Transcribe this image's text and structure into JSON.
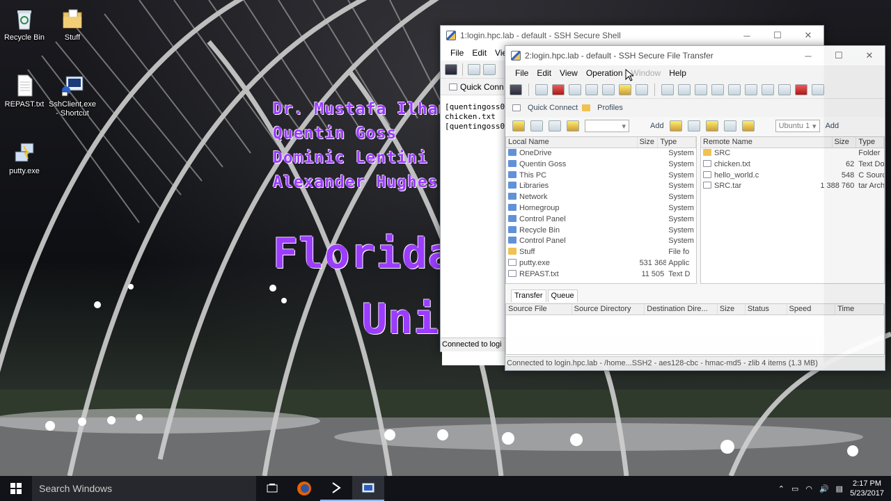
{
  "desktop": {
    "icons": [
      {
        "label": "Recycle Bin"
      },
      {
        "label": "Stuff"
      },
      {
        "label": "REPAST.txt"
      },
      {
        "label": "SshClient.exe - Shortcut"
      },
      {
        "label": "putty.exe"
      }
    ],
    "slide": {
      "names": [
        "Dr. Mustafa Ilhan",
        "Quentin Goss",
        "Dominic Lentini",
        "Alexander Hughes"
      ],
      "title1": "Florida",
      "title2": "Univ"
    }
  },
  "shell": {
    "title": "1:login.hpc.lab - default - SSH Secure Shell",
    "menu": [
      "File",
      "Edit",
      "Vie"
    ],
    "quick_connect": "Quick Conn",
    "terminal_lines": [
      "[quentingoss0",
      "chicken.txt",
      "[quentingoss0"
    ],
    "status": "Connected to logi"
  },
  "sftp": {
    "title": "2:login.hpc.lab - default - SSH Secure File Transfer",
    "menu": [
      "File",
      "Edit",
      "View",
      "Operation",
      "Window",
      "Help"
    ],
    "quick_connect": "Quick Connect",
    "profiles": "Profiles",
    "add_left": "Add",
    "add_right": "Add",
    "remote_combo": "Ubuntu 1",
    "local": {
      "headers": [
        "Local Name",
        "Size",
        "Type"
      ],
      "rows": [
        {
          "name": "OneDrive",
          "size": "",
          "type": "System"
        },
        {
          "name": "Quentin Goss",
          "size": "",
          "type": "System"
        },
        {
          "name": "This PC",
          "size": "",
          "type": "System"
        },
        {
          "name": "Libraries",
          "size": "",
          "type": "System"
        },
        {
          "name": "Network",
          "size": "",
          "type": "System"
        },
        {
          "name": "Homegroup",
          "size": "",
          "type": "System"
        },
        {
          "name": "Control Panel",
          "size": "",
          "type": "System"
        },
        {
          "name": "Recycle Bin",
          "size": "",
          "type": "System"
        },
        {
          "name": "Control Panel",
          "size": "",
          "type": "System"
        },
        {
          "name": "Stuff",
          "size": "",
          "type": "File fo"
        },
        {
          "name": "putty.exe",
          "size": "531 368",
          "type": "Applic"
        },
        {
          "name": "REPAST.txt",
          "size": "11 505",
          "type": "Text D"
        }
      ]
    },
    "remote": {
      "headers": [
        "Remote Name",
        "Size",
        "Type"
      ],
      "rows": [
        {
          "name": "SRC",
          "size": "",
          "type": "Folder"
        },
        {
          "name": "chicken.txt",
          "size": "62",
          "type": "Text Do"
        },
        {
          "name": "hello_world.c",
          "size": "548",
          "type": "C Sourc"
        },
        {
          "name": "SRC.tar",
          "size": "1 388 760",
          "type": "tar Arch"
        }
      ]
    },
    "tabs": [
      "Transfer",
      "Queue"
    ],
    "transfer_headers": [
      "Source File",
      "Source Directory",
      "Destination Dire...",
      "Size",
      "Status",
      "Speed",
      "Time"
    ],
    "status": "Connected to login.hpc.lab - /home...SSH2 - aes128-cbc - hmac-md5 - zlib 4 items (1.3 MB)"
  },
  "taskbar": {
    "search_placeholder": "Search Windows",
    "time": "2:17 PM",
    "date": "5/23/2017"
  }
}
